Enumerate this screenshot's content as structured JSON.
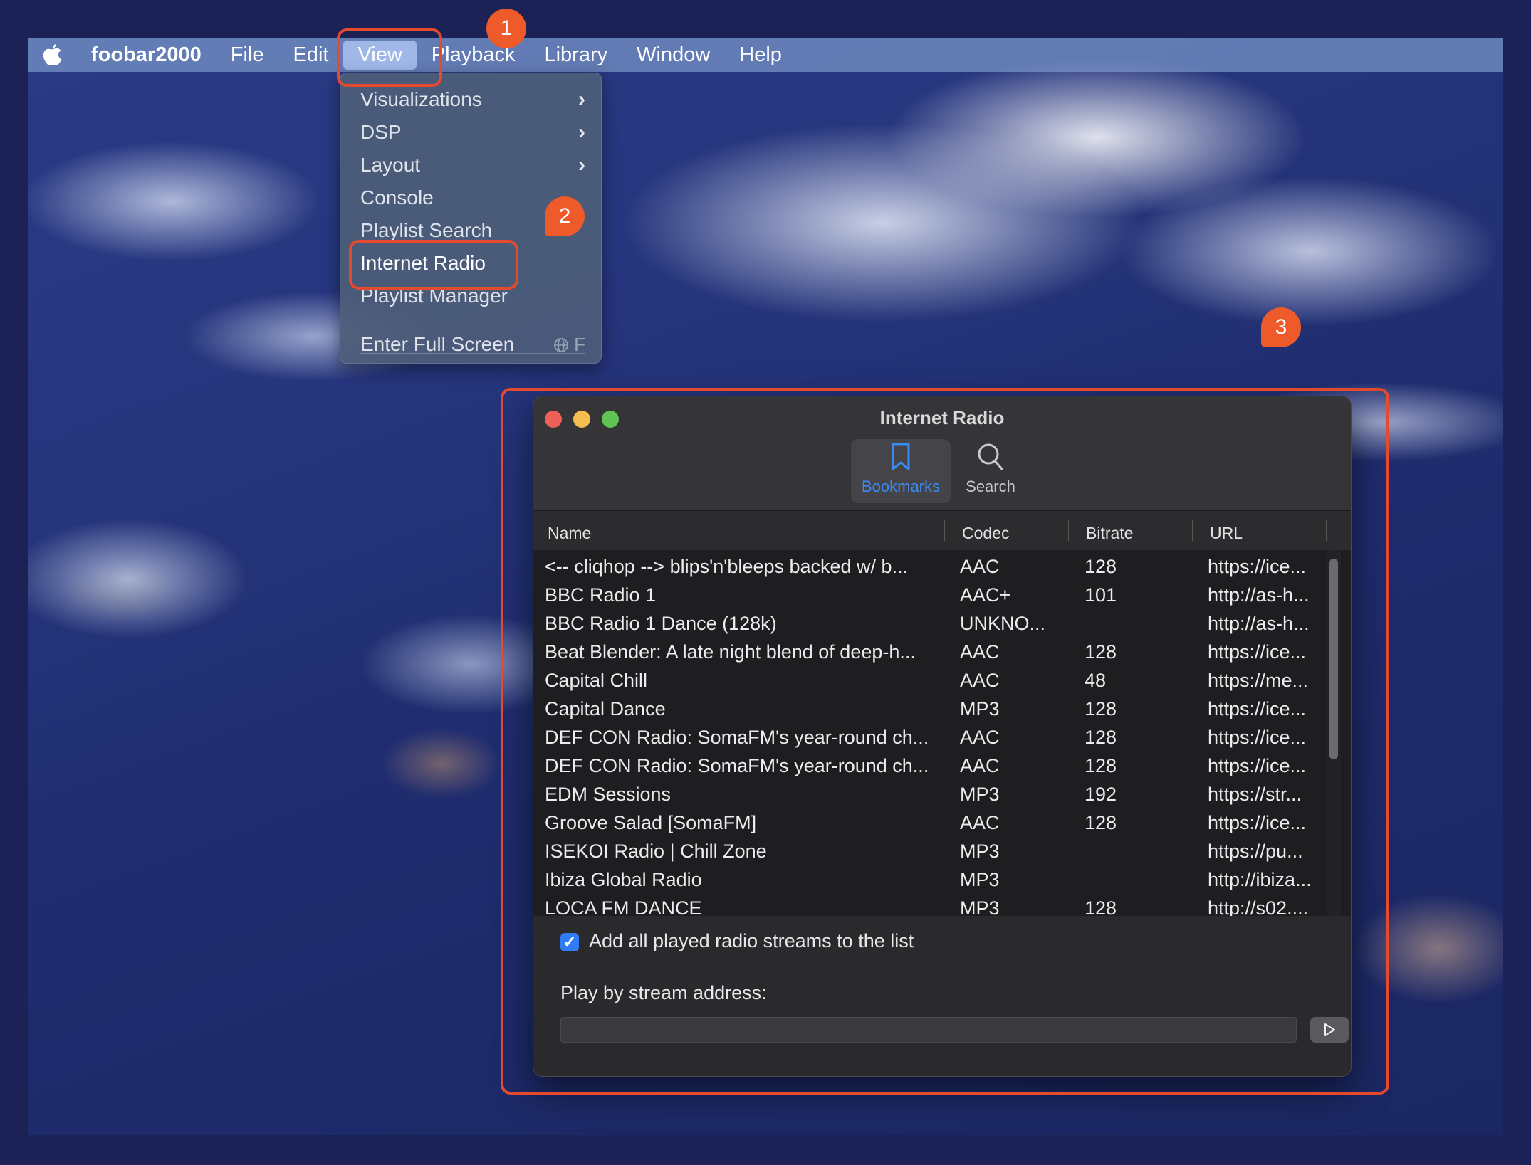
{
  "menubar": {
    "apple_icon": "apple-logo-icon",
    "app_name": "foobar2000",
    "items": [
      "File",
      "Edit",
      "View",
      "Playback",
      "Library",
      "Window",
      "Help"
    ]
  },
  "view_menu": {
    "items": [
      {
        "label": "Visualizations",
        "submenu": true
      },
      {
        "label": "DSP",
        "submenu": true
      },
      {
        "label": "Layout",
        "submenu": true
      },
      {
        "label": "Console",
        "submenu": false
      },
      {
        "label": "Playlist Search",
        "submenu": false
      },
      {
        "label": "Internet Radio",
        "submenu": false
      },
      {
        "label": "Playlist Manager",
        "submenu": false
      }
    ],
    "fullscreen": {
      "label": "Enter Full Screen",
      "shortcut_globe": "globe-icon",
      "shortcut_key": "F"
    }
  },
  "annotations": {
    "badge1": "1",
    "badge2": "2",
    "badge3": "3",
    "highlight_color": "#e64a2e"
  },
  "window": {
    "title": "Internet Radio",
    "toolbar": {
      "bookmarks": "Bookmarks",
      "search": "Search"
    },
    "columns": {
      "name": "Name",
      "codec": "Codec",
      "bitrate": "Bitrate",
      "url": "URL"
    },
    "rows": [
      {
        "name": "<-- cliqhop --> blips'n'bleeps backed w/ b...",
        "codec": "AAC",
        "bitrate": "128",
        "url": "https://ice..."
      },
      {
        "name": "BBC Radio 1",
        "codec": "AAC+",
        "bitrate": "101",
        "url": "http://as-h..."
      },
      {
        "name": "BBC Radio 1 Dance (128k)",
        "codec": "UNKNO...",
        "bitrate": "",
        "url": "http://as-h..."
      },
      {
        "name": "Beat Blender: A late night blend of deep-h...",
        "codec": "AAC",
        "bitrate": "128",
        "url": "https://ice..."
      },
      {
        "name": "Capital Chill",
        "codec": "AAC",
        "bitrate": "48",
        "url": "https://me..."
      },
      {
        "name": "Capital Dance",
        "codec": "MP3",
        "bitrate": "128",
        "url": "https://ice..."
      },
      {
        "name": "DEF CON Radio: SomaFM's year-round ch...",
        "codec": "AAC",
        "bitrate": "128",
        "url": "https://ice..."
      },
      {
        "name": "DEF CON Radio: SomaFM's year-round ch...",
        "codec": "AAC",
        "bitrate": "128",
        "url": "https://ice..."
      },
      {
        "name": "EDM Sessions",
        "codec": "MP3",
        "bitrate": "192",
        "url": "https://str..."
      },
      {
        "name": "Groove Salad [SomaFM]",
        "codec": "AAC",
        "bitrate": "128",
        "url": "https://ice..."
      },
      {
        "name": "ISEKOI Radio | Chill Zone",
        "codec": "MP3",
        "bitrate": "",
        "url": "https://pu..."
      },
      {
        "name": "Ibiza Global Radio",
        "codec": "MP3",
        "bitrate": "",
        "url": "http://ibiza..."
      },
      {
        "name": "LOCA FM DANCE",
        "codec": "MP3",
        "bitrate": "128",
        "url": "http://s02...."
      }
    ],
    "add_played_label": "Add all played radio streams to the list",
    "add_played_checked": true,
    "play_label": "Play by stream address:",
    "address_value": "",
    "play_icon": "play-triangle-icon"
  },
  "colors": {
    "accent": "#2f7cf6",
    "annotation": "#ee5a2a"
  }
}
